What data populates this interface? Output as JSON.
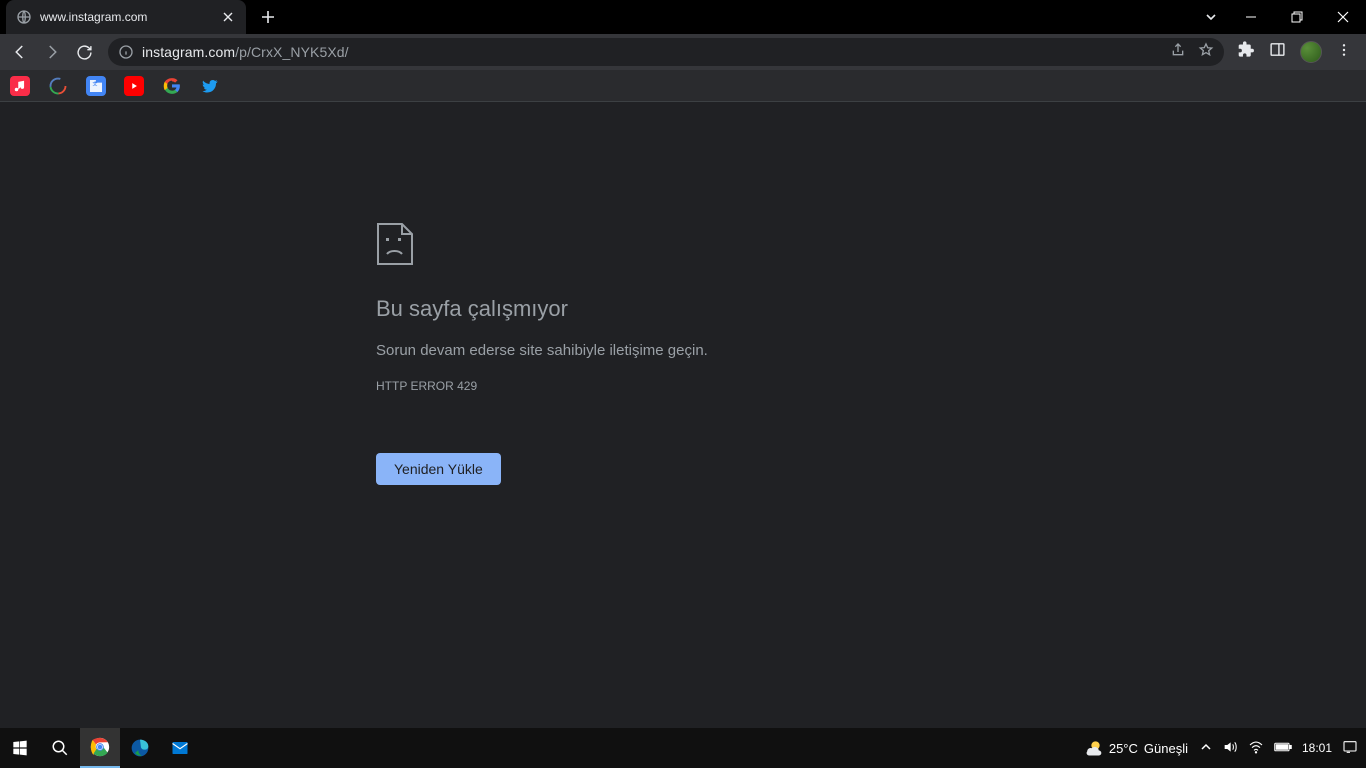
{
  "tab": {
    "title": "www.instagram.com"
  },
  "omnibox": {
    "host": "instagram.com",
    "path": "/p/CrxX_NYK5Xd/"
  },
  "error": {
    "title": "Bu sayfa çalışmıyor",
    "message": "Sorun devam ederse site sahibiyle iletişime geçin.",
    "code": "HTTP ERROR 429",
    "reload_label": "Yeniden Yükle"
  },
  "taskbar": {
    "weather_temp": "25°C",
    "weather_desc": "Güneşli",
    "time": "18:01"
  }
}
